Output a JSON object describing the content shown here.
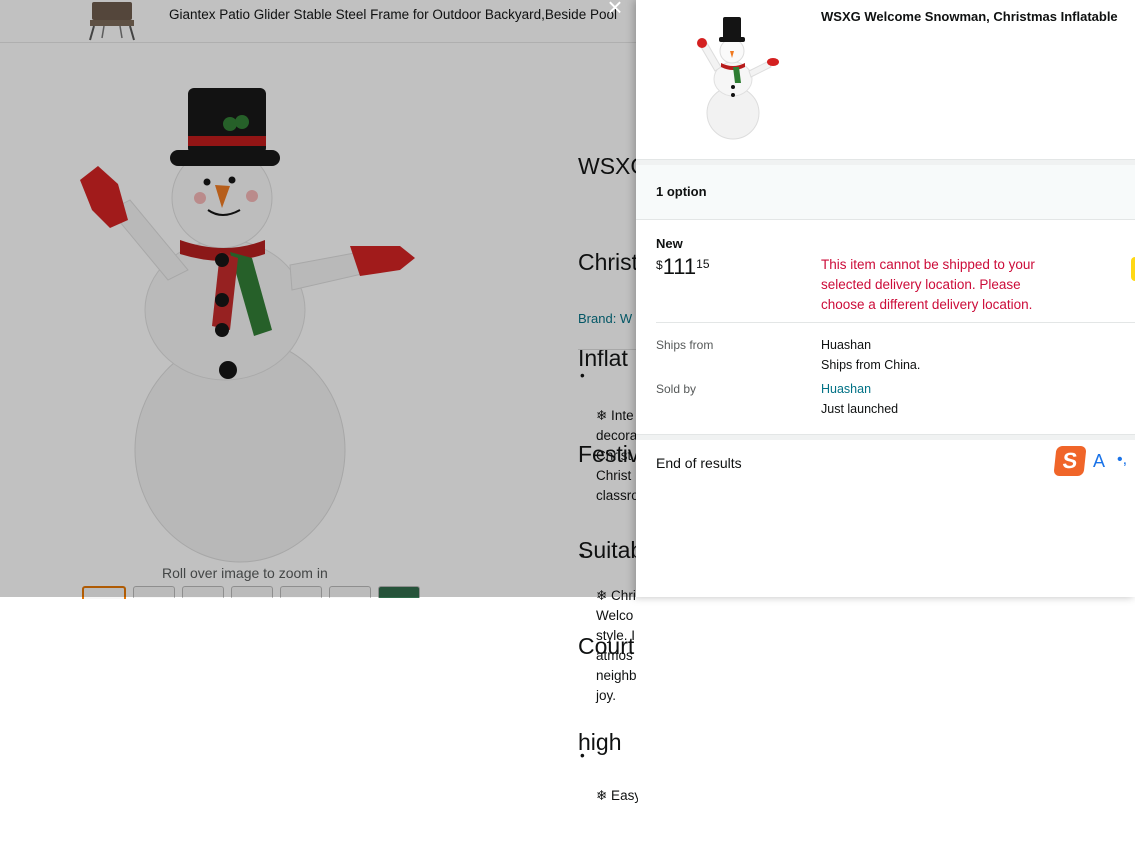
{
  "background_page": {
    "strip_title": "Giantex Patio Glider Stable Steel Frame for Outdoor Backyard,Beside Pool",
    "product_title_lines": [
      "WSXG",
      "Christ",
      "Inflat",
      "Festiv",
      "Suitab",
      "Court",
      "high"
    ],
    "brand_link": "Brand: W",
    "zoom_hint": "Roll over image to zoom in",
    "bullets": [
      [
        "❄ Inte",
        "decora",
        "Christ",
        "Christ",
        "classro"
      ],
      [
        "❄ Chri",
        "Welco",
        "style. I",
        "atmos",
        "neighb",
        "joy."
      ],
      [
        "❄ Easy"
      ]
    ]
  },
  "panel": {
    "close_icon": "×",
    "product_title": "WSXG Welcome Snowman, Christmas Inflatable",
    "options_count": "1 option",
    "condition": "New",
    "price": {
      "symbol": "$",
      "whole": "111",
      "fraction": "15"
    },
    "warning": "This item cannot be shipped to your selected delivery location. Please choose a different delivery location.",
    "ships_from_label": "Ships from",
    "ships_from_value": "Huashan",
    "ships_from_note": "Ships from China.",
    "sold_by_label": "Sold by",
    "sold_by_value": "Huashan",
    "sold_by_note": "Just launched",
    "end_of_results": "End of results"
  },
  "ime_toolbar": {
    "logo": "S",
    "mode": "A",
    "punct": "•,"
  },
  "colors": {
    "warning": "#cc0c39",
    "link": "#007185",
    "accent": "#ffd814",
    "selected_thumb": "#e77600"
  }
}
